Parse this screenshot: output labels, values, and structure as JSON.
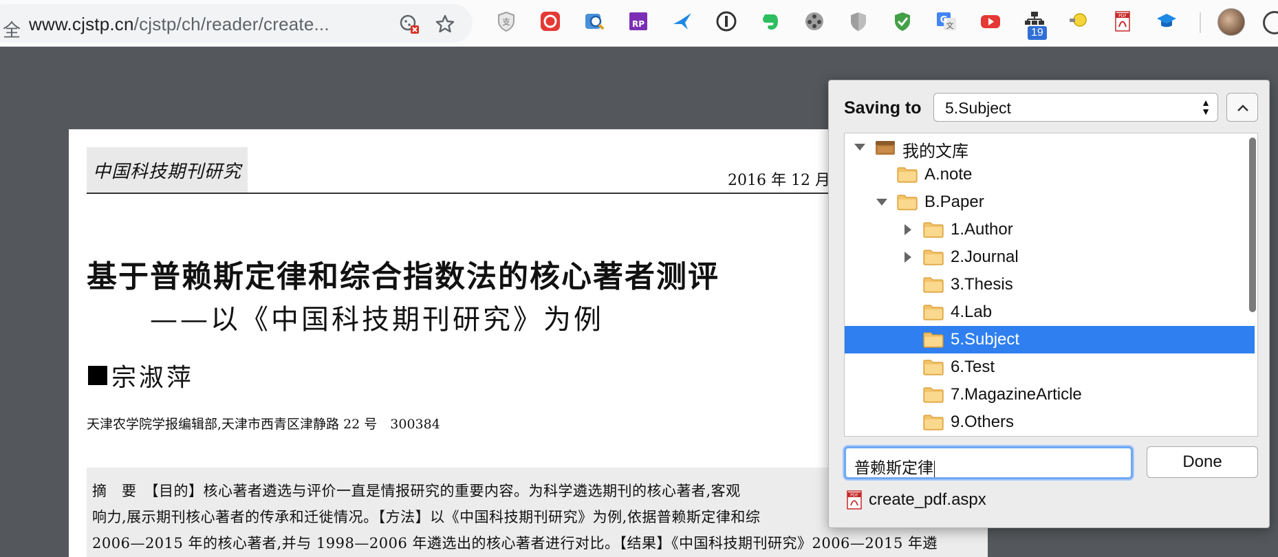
{
  "browser": {
    "left_glyph": "全",
    "url_host": "www.cjstp.cn",
    "url_path": "/cjstp/ch/reader/create...",
    "extension_badge": "19"
  },
  "pdf": {
    "journal_logo": "中国科技期刊研究",
    "issue_date": "2016 年 12 月",
    "title": "基于普赖斯定律和综合指数法的核心著者测评",
    "subtitle": "——以《中国科技期刊研究》为例",
    "author": "宗淑萍",
    "affiliation": "天津农学院学报编辑部,天津市西青区津静路 22 号　300384",
    "abstract_lines": [
      "摘　要　【目的】核心著者遴选与评价一直是情报研究的重要内容。为科学遴选期刊的核心著者,客观",
      "响力,展示期刊核心著者的传承和迁徙情况。【方法】以《中国科技期刊研究》为例,依据普赖斯定律和综",
      "2006—2015 年的核心著者,并与 1998—2006 年遴选出的核心著者进行对比。【结果】《中国科技期刊研究》2006—2015 年遴"
    ]
  },
  "popup": {
    "saving_label": "Saving to",
    "selected_collection": "5.Subject",
    "tree": [
      {
        "label": "我的文库",
        "level": 0,
        "twisty": "open",
        "icon": "library-icon",
        "selected": false
      },
      {
        "label": "A.note",
        "level": 1,
        "twisty": "none",
        "icon": "folder-icon",
        "selected": false
      },
      {
        "label": "B.Paper",
        "level": 1,
        "twisty": "open",
        "icon": "folder-icon",
        "selected": false
      },
      {
        "label": "1.Author",
        "level": 2,
        "twisty": "closed",
        "icon": "folder-icon",
        "selected": false
      },
      {
        "label": "2.Journal",
        "level": 2,
        "twisty": "closed",
        "icon": "folder-icon",
        "selected": false
      },
      {
        "label": "3.Thesis",
        "level": 2,
        "twisty": "none",
        "icon": "folder-icon",
        "selected": false
      },
      {
        "label": "4.Lab",
        "level": 2,
        "twisty": "none",
        "icon": "folder-icon",
        "selected": false
      },
      {
        "label": "5.Subject",
        "level": 2,
        "twisty": "none",
        "icon": "folder-icon",
        "selected": true
      },
      {
        "label": "6.Test",
        "level": 2,
        "twisty": "none",
        "icon": "folder-icon",
        "selected": false
      },
      {
        "label": "7.MagazineArticle",
        "level": 2,
        "twisty": "none",
        "icon": "folder-icon",
        "selected": false
      },
      {
        "label": "9.Others",
        "level": 2,
        "twisty": "none",
        "icon": "folder-icon",
        "selected": false
      }
    ],
    "filename_value": "普赖斯定律",
    "done_label": "Done",
    "attachment_name": "create_pdf.aspx"
  },
  "colors": {
    "selection": "#2f7ff0",
    "page_background": "#54575b",
    "focus_ring": "#6ea7f5"
  }
}
